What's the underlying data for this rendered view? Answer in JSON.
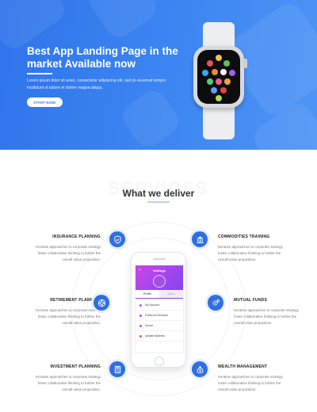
{
  "hero": {
    "title": "Best App Landing Page in the market Available now",
    "description": "Lorem ipsum dolor sit amet, consectetur adipiscing elit, sed do eiusmod tempor incididunt ut labore et dolore magna aliqua.",
    "cta_label": "START NOW!",
    "accent_color": "#3180ee"
  },
  "services": {
    "ghost_text": "SERVICES",
    "title": "What we deliver",
    "items": [
      {
        "title": "INSURANCE PLANNING",
        "text": "Kerative approaches to corporate strategy foster collaborative thinking to further the overall value proposition.",
        "icon": "shield-icon"
      },
      {
        "title": "RETIREMENT PLANNING",
        "text": "Kerative approaches to corporate strategy foster collaborative thinking to further the overall value proposition.",
        "icon": "life-ring-icon"
      },
      {
        "title": "INVESTMENT PLANNING",
        "text": "Kerative approaches to corporate strategy foster collaborative thinking to further the overall value proposition.",
        "icon": "calculator-icon"
      },
      {
        "title": "COMMODITIES TRAINING",
        "text": "Kerative approaches to corporate strategy foster collaborative thinking to further the overall value proposition.",
        "icon": "building-icon"
      },
      {
        "title": "MUTUAL FUNDS",
        "text": "Kerative approaches to corporate strategy foster collaborative thinking to further the overall value proposition.",
        "icon": "cogs-icon"
      },
      {
        "title": "WEALTH MANAGEMENT",
        "text": "Kerative approaches to corporate strategy foster collaborative thinking to further the overall value proposition.",
        "icon": "money-bag-icon"
      }
    ]
  },
  "phone": {
    "header_title": "Settings",
    "back_glyph": "<",
    "tabs": [
      "Profile",
      "Menu"
    ],
    "menu": [
      "My Account",
      "Preferred Services",
      "Social",
      "Update Address"
    ],
    "header_color": "#b246ea"
  }
}
